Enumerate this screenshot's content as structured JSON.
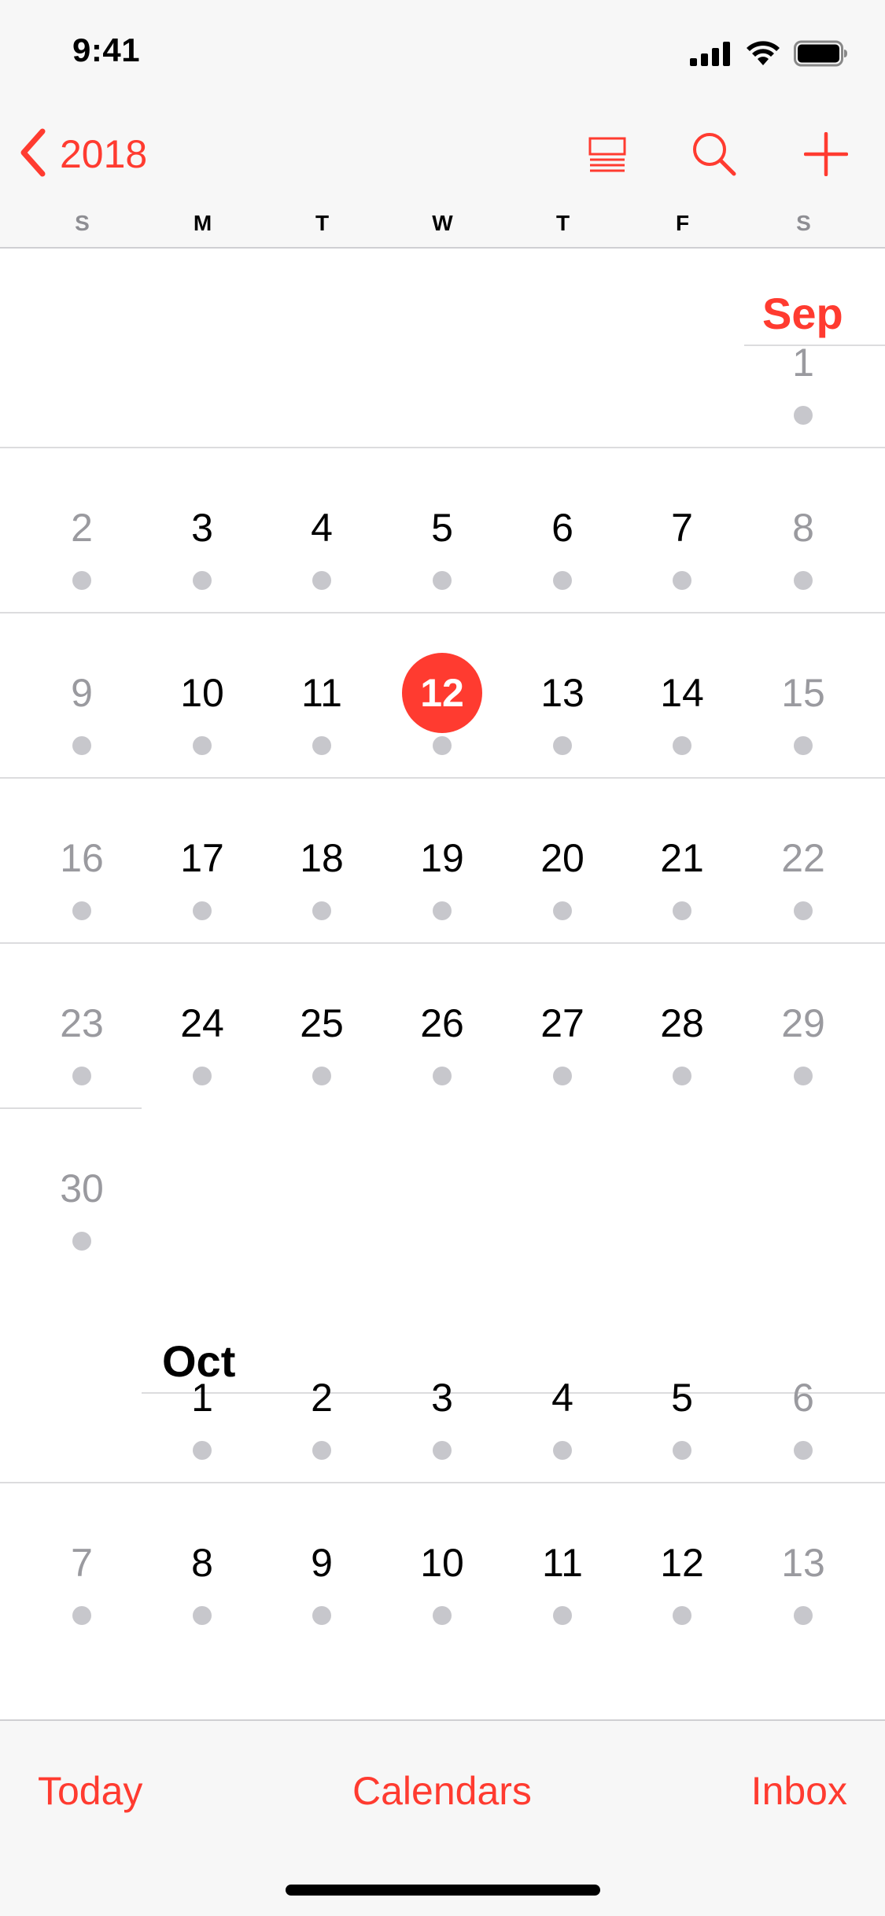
{
  "status_bar": {
    "time": "9:41"
  },
  "nav": {
    "back_label": "2018"
  },
  "weekdays": [
    "S",
    "M",
    "T",
    "W",
    "T",
    "F",
    "S"
  ],
  "colors": {
    "accent": "#ff3b30",
    "dot": "#c7c7cc",
    "weekend_text": "#9a9a9f"
  },
  "calendar": {
    "months": [
      {
        "name": "Sep",
        "today": "12",
        "weeks": [
          [
            "",
            "",
            "",
            "",
            "",
            "",
            "1"
          ],
          [
            "2",
            "3",
            "4",
            "5",
            "6",
            "7",
            "8"
          ],
          [
            "9",
            "10",
            "11",
            "12",
            "13",
            "14",
            "15"
          ],
          [
            "16",
            "17",
            "18",
            "19",
            "20",
            "21",
            "22"
          ],
          [
            "23",
            "24",
            "25",
            "26",
            "27",
            "28",
            "29"
          ],
          [
            "30",
            "",
            "",
            "",
            "",
            "",
            ""
          ]
        ]
      },
      {
        "name": "Oct",
        "weeks": [
          [
            "",
            "1",
            "2",
            "3",
            "4",
            "5",
            "6"
          ],
          [
            "7",
            "8",
            "9",
            "10",
            "11",
            "12",
            "13"
          ]
        ]
      }
    ]
  },
  "toolbar": {
    "today": "Today",
    "calendars": "Calendars",
    "inbox": "Inbox"
  }
}
